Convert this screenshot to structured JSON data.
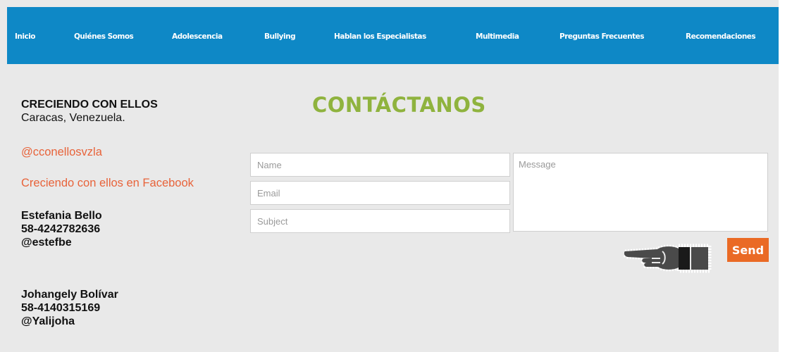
{
  "nav": {
    "items": [
      {
        "label": "Inicio"
      },
      {
        "label": "Quiénes Somos"
      },
      {
        "label": "Adolescencia"
      },
      {
        "label": "Bullying"
      },
      {
        "label": "Hablan los Especialistas"
      },
      {
        "label": "Multimedia"
      },
      {
        "label": "Preguntas Frecuentes"
      },
      {
        "label": "Recomendaciones"
      }
    ]
  },
  "contact_info": {
    "org": "CRECIENDO CON ELLOS",
    "location": "Caracas, Venezuela.",
    "twitter": "@cconellosvzla",
    "facebook": "Creciendo con ellos en Facebook",
    "people": [
      {
        "name": "Estefania Bello",
        "phone": "58-4242782636",
        "handle": "@estefbe"
      },
      {
        "name": "Johangely Bolívar",
        "phone": "58-4140315169",
        "handle": "@Yalijoha"
      }
    ]
  },
  "form": {
    "title": "CONTÁCTANOS",
    "name_placeholder": "Name",
    "email_placeholder": "Email",
    "subject_placeholder": "Subject",
    "message_placeholder": "Message",
    "send_label": "Send"
  },
  "colors": {
    "nav_bg": "#0e88c6",
    "page_bg": "#e9e9e9",
    "title": "#8fb33e",
    "link": "#e8633a",
    "send": "#ea6a25"
  },
  "icons": {
    "pointer": "pointing-hand-icon"
  }
}
